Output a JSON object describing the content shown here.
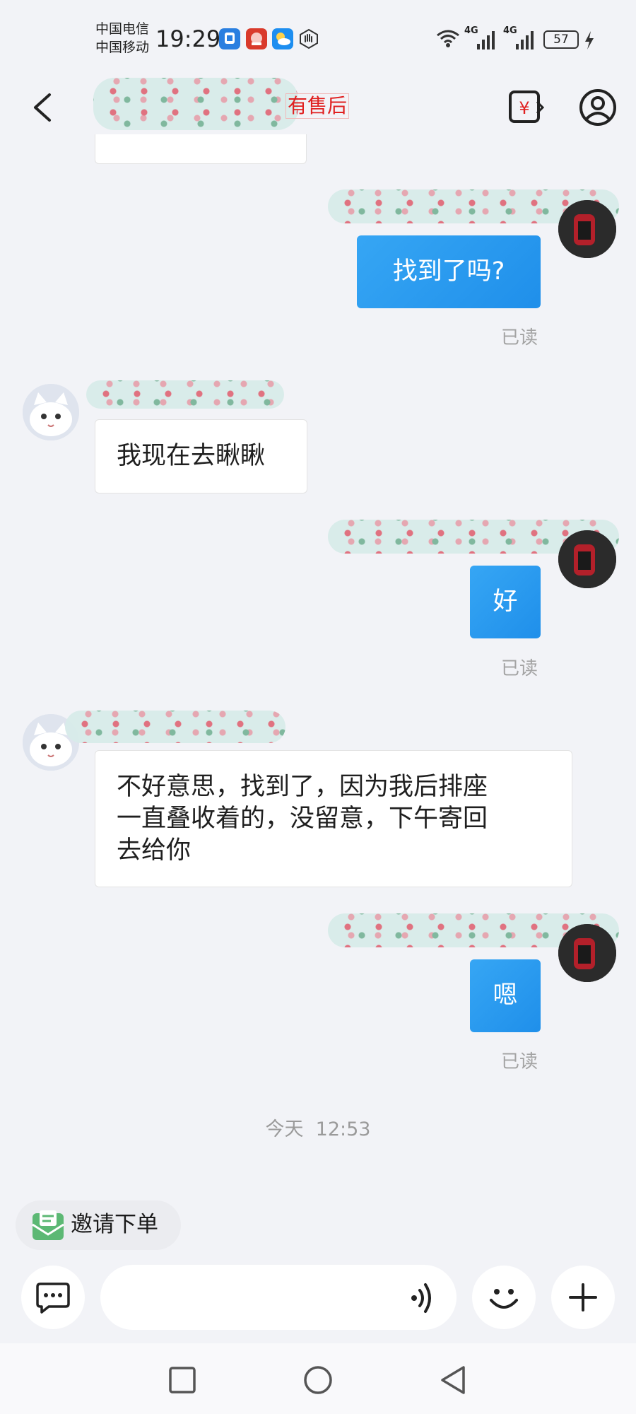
{
  "status_bar": {
    "carrier_1": "中国电信",
    "carrier_2": "中国移动",
    "time": "19:29",
    "signal_1_label": "4G",
    "signal_2_label": "4G",
    "battery": "57"
  },
  "header": {
    "tag": "有售后"
  },
  "messages": [
    {
      "side": "out",
      "text": "找到了吗?",
      "status": "已读"
    },
    {
      "side": "in",
      "text": "我现在去瞅瞅"
    },
    {
      "side": "out",
      "text": "好",
      "status": "已读"
    },
    {
      "side": "in",
      "lines": [
        "不好意思，找到了，因为我后排座",
        "一直叠收着的，没留意，下午寄回",
        "去给你"
      ]
    },
    {
      "side": "out",
      "text": "嗯",
      "status": "已读"
    }
  ],
  "timestamp": "今天  12:53",
  "invite_order": {
    "label": "邀请下单"
  },
  "colors": {
    "bubble_out": "#2196f3",
    "tag_red": "#e02020",
    "invite_green": "#5cb874",
    "background": "#f2f3f7"
  }
}
